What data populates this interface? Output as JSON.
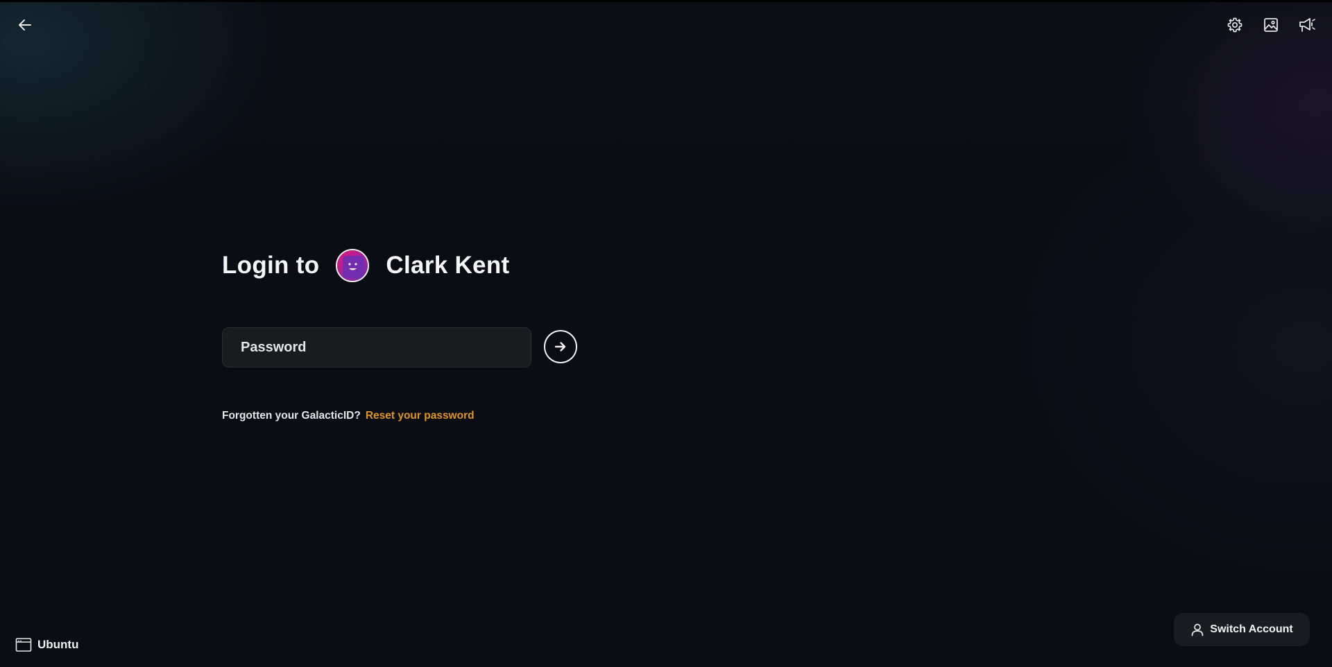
{
  "header": {
    "back_icon": "arrow-left-icon",
    "settings_icon": "gear-icon",
    "wallpaper_icon": "image-icon",
    "announcements_icon": "megaphone-icon"
  },
  "login": {
    "title_prefix": "Login to",
    "user_name": "Clark Kent",
    "avatar_icon": "smiley-avatar-icon",
    "avatar_colors": [
      "#e4187a",
      "#6b2fb4"
    ]
  },
  "password": {
    "placeholder": "Password",
    "value": ""
  },
  "submit": {
    "icon": "arrow-right-icon"
  },
  "forgot": {
    "text": "Forgotten your GalacticID?",
    "link": "Reset your password",
    "link_color": "#e0961c"
  },
  "session": {
    "icon": "window-icon",
    "label": "Ubuntu"
  },
  "switch_account": {
    "icon": "user-icon",
    "label": "Switch Account"
  }
}
